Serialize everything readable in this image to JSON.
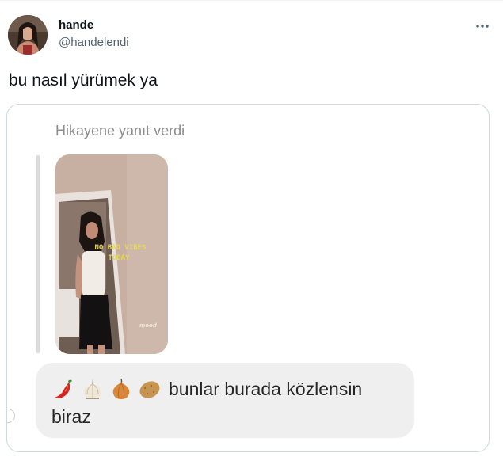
{
  "user": {
    "display_name": "hande",
    "handle": "@handelendi"
  },
  "tweet": {
    "text": "bu nasıl yürümek ya"
  },
  "actions": {
    "more_icon": "more-horizontal-icon"
  },
  "media": {
    "reply_caption": "Hikayene yanıt verdi",
    "story": {
      "overlay_text_line1": "NO BAD VIBES",
      "overlay_text_line2": "TODAY",
      "sticker": "mood"
    },
    "message": {
      "emojis": [
        "hot-pepper",
        "garlic",
        "onion",
        "potato"
      ],
      "text_line1": "bunlar burada közlensin",
      "text_line2": "biraz"
    }
  },
  "colors": {
    "text_primary": "#0f1419",
    "text_secondary": "#536471",
    "caption_gray": "#8e8e8e",
    "bubble_bg": "#efefef",
    "card_border": "#cfd9de"
  }
}
